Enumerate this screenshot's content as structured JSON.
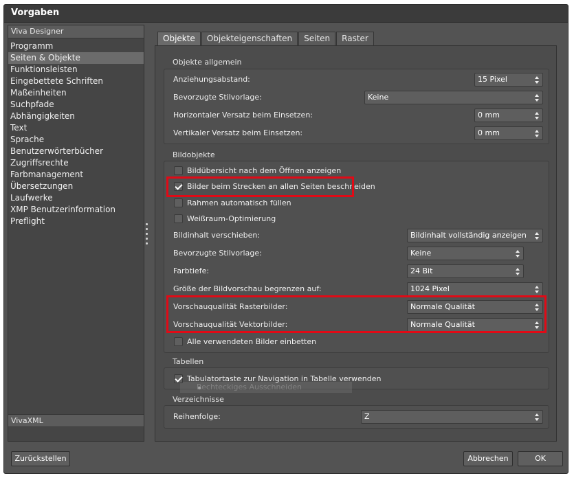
{
  "window": {
    "title": "Vorgaben"
  },
  "sidebar": {
    "header": "Viva Designer",
    "items": [
      "Programm",
      "Seiten & Objekte",
      "Funktionsleisten",
      "Eingebettete Schriften",
      "Maßeinheiten",
      "Suchpfade",
      "Abhängigkeiten",
      "Text",
      "Sprache",
      "Benutzerwörterbücher",
      "Zugriffsrechte",
      "Farbmanagement",
      "Übersetzungen",
      "Laufwerke",
      "XMP Benutzerinformation",
      "Preflight"
    ],
    "selected": "Seiten & Objekte",
    "bottom_header": "VivaXML"
  },
  "tabs": [
    "Objekte",
    "Objekteigenschaften",
    "Seiten",
    "Raster"
  ],
  "active_tab": "Objekte",
  "objekte_allgemein": {
    "title": "Objekte allgemein",
    "anziehungsabstand_label": "Anziehungsabstand:",
    "anziehungsabstand_value": "15 Pixel",
    "stilvorlage_label": "Bevorzugte Stilvorlage:",
    "stilvorlage_value": "Keine",
    "h_versatz_label": "Horizontaler Versatz beim Einsetzen:",
    "h_versatz_value": "0 mm",
    "v_versatz_label": "Vertikaler Versatz beim Einsetzen:",
    "v_versatz_value": "0 mm"
  },
  "bildobjekte": {
    "title": "Bildobjekte",
    "cb_uebersicht": {
      "label": "Bildübersicht nach dem Öffnen anzeigen",
      "checked": false
    },
    "cb_strecken": {
      "label": "Bilder beim Strecken an allen Seiten beschneiden",
      "checked": true
    },
    "cb_rahmen": {
      "label": "Rahmen automatisch füllen",
      "checked": false
    },
    "cb_weissraum": {
      "label": "Weißraum-Optimierung",
      "checked": false
    },
    "verschieben_label": "Bildinhalt verschieben:",
    "verschieben_value": "Bildinhalt vollständig anzeigen",
    "stilvorlage_label": "Bevorzugte Stilvorlage:",
    "stilvorlage_value": "Keine",
    "farbtiefe_label": "Farbtiefe:",
    "farbtiefe_value": "24 Bit",
    "vorschau_label": "Größe der Bildvorschau begrenzen auf:",
    "vorschau_value": "1024 Pixel",
    "raster_label": "Vorschauqualität Rasterbilder:",
    "raster_value": "Normale Qualität",
    "vektor_label": "Vorschauqualität Vektorbilder:",
    "vektor_value": "Normale Qualität",
    "cb_einbetten": {
      "label": "Alle verwendeten Bilder einbetten",
      "checked": false
    }
  },
  "tabellen": {
    "title": "Tabellen",
    "cb_tabulator": {
      "label": "Tabulatortaste zur Navigation in Tabelle verwenden",
      "checked": true
    },
    "ghost_text": "Rechteckiges Ausschneiden"
  },
  "verzeichnisse": {
    "title": "Verzeichnisse",
    "reihenfolge_label": "Reihenfolge:",
    "reihenfolge_value": "Z"
  },
  "buttons": {
    "reset": "Zurückstellen",
    "cancel": "Abbrechen",
    "ok": "OK"
  },
  "colors": {
    "highlight": "#e10a16",
    "background": "#535353",
    "titlebar": "#3b3b3b"
  },
  "icons": {
    "select_arrows": "up-down-arrows-icon",
    "checkmark": "checkmark-icon",
    "splitter": "splitter-grip-icon"
  }
}
